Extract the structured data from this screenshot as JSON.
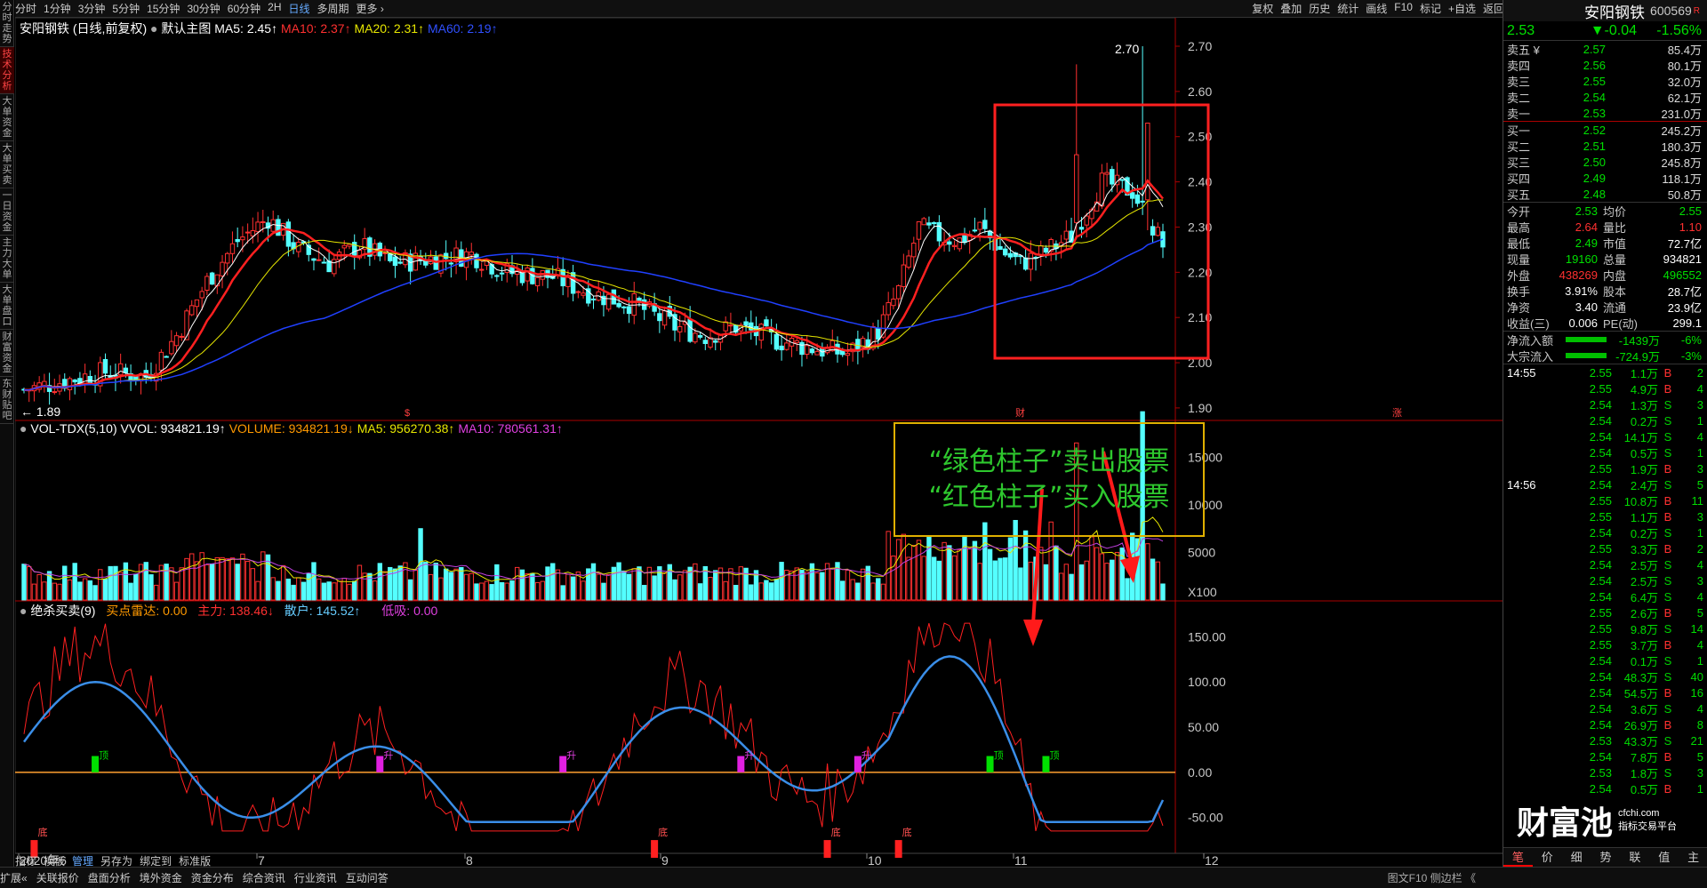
{
  "side_tabs": [
    "分时走势",
    "技术分析",
    "大单资金",
    "大单买卖",
    "一日资金",
    "主力大单",
    "大单盘口",
    "财富资金",
    "东财贴吧"
  ],
  "topbar": {
    "periods": [
      "分时",
      "1分钟",
      "3分钟",
      "5分钟",
      "15分钟",
      "30分钟",
      "60分钟",
      "2H",
      "日线",
      "多周期",
      "更多 ›"
    ],
    "active": "日线",
    "tools": [
      "复权",
      "叠加",
      "历史",
      "统计",
      "画线",
      "F10",
      "标记",
      "+自选",
      "返回"
    ]
  },
  "main": {
    "title": "安阳钢铁 (日线,前复权)",
    "template": "默认主图",
    "ma5": "MA5: 2.45↑",
    "ma10": "MA10: 2.37↑",
    "ma20": "MA20: 2.31↑",
    "ma60": "MA60: 2.19↑",
    "high_label": "2.70",
    "low_label": "1.89",
    "yticks": [
      "2.70",
      "2.60",
      "2.50",
      "2.40",
      "2.30",
      "2.20",
      "2.10",
      "2.00",
      "1.90"
    ],
    "markers": [
      "$",
      "财",
      "涨"
    ]
  },
  "vol": {
    "title": "VOL-TDX(5,10) VVOL: 934821.19↑",
    "volume": "VOLUME: 934821.19↓",
    "ma5": "MA5: 956270.38↑",
    "ma10": "MA10: 780561.31↑",
    "yticks": [
      "15000",
      "10000",
      "5000",
      "X100"
    ]
  },
  "ind": {
    "title": "绝杀买卖(9)",
    "buy": "买点雷达: 0.00",
    "main": "主力: 138.46↓",
    "retail": "散户: 145.52↑",
    "low": "低吸: 0.00",
    "yticks": [
      "150.00",
      "100.00",
      "50.00",
      "0.00",
      "-50.00"
    ],
    "labels": [
      "顶",
      "升",
      "底"
    ]
  },
  "annotation": {
    "line1": "“绿色柱子”卖出股票",
    "line2": "“红色柱子”买入股票"
  },
  "xaxis": [
    "2020年6",
    "7",
    "8",
    "9",
    "10",
    "11",
    "12"
  ],
  "bottom_tabs": [
    "指标",
    "模板",
    "管理",
    "另存为",
    "绑定到",
    "标准版"
  ],
  "bottom_bar": [
    "扩展«",
    "关联报价",
    "盘面分析",
    "境外资金",
    "资金分布",
    "综合资讯",
    "行业资讯",
    "互动问答"
  ],
  "bottom_right": "图文F10 侧边栏 《",
  "right": {
    "name": "安阳钢铁",
    "code": "600569",
    "price": "2.53",
    "change": "▼-0.04",
    "pct": "-1.56%",
    "asks": [
      [
        "卖五 ¥",
        "2.57",
        "85.4万"
      ],
      [
        "卖四",
        "2.56",
        "80.1万"
      ],
      [
        "卖三",
        "2.55",
        "32.0万"
      ],
      [
        "卖二",
        "2.54",
        "62.1万"
      ],
      [
        "卖一",
        "2.53",
        "231.0万"
      ]
    ],
    "bids": [
      [
        "买一",
        "2.52",
        "245.2万"
      ],
      [
        "买二",
        "2.51",
        "180.3万"
      ],
      [
        "买三",
        "2.50",
        "245.8万"
      ],
      [
        "买四",
        "2.49",
        "118.1万"
      ],
      [
        "买五",
        "2.48",
        "50.8万"
      ]
    ],
    "stats": [
      [
        "今开",
        "2.53",
        "均价",
        "2.55"
      ],
      [
        "最高",
        "2.64",
        "量比",
        "1.10"
      ],
      [
        "最低",
        "2.49",
        "市值",
        "72.7亿"
      ],
      [
        "现量",
        "19160",
        "总量",
        "934821"
      ],
      [
        "外盘",
        "438269",
        "内盘",
        "496552"
      ],
      [
        "换手",
        "3.91%",
        "股本",
        "28.7亿"
      ],
      [
        "净资",
        "3.40",
        "流通",
        "23.9亿"
      ],
      [
        "收益(三)",
        "0.006",
        "PE(动)",
        "299.1"
      ]
    ],
    "flows": [
      [
        "净流入额",
        "-1439万",
        "-6%"
      ],
      [
        "大宗流入",
        "-724.9万",
        "-3%"
      ]
    ],
    "ticks": [
      [
        "14:55",
        "2.55",
        "1.1万",
        "B",
        "2"
      ],
      [
        "",
        "2.55",
        "4.9万",
        "B",
        "4"
      ],
      [
        "",
        "2.54",
        "1.3万",
        "S",
        "3"
      ],
      [
        "",
        "2.54",
        "0.2万",
        "S",
        "1"
      ],
      [
        "",
        "2.54",
        "14.1万",
        "S",
        "4"
      ],
      [
        "",
        "2.54",
        "0.5万",
        "S",
        "1"
      ],
      [
        "",
        "2.55",
        "1.9万",
        "B",
        "3"
      ],
      [
        "14:56",
        "2.54",
        "2.4万",
        "S",
        "5"
      ],
      [
        "",
        "2.55",
        "10.8万",
        "B",
        "11"
      ],
      [
        "",
        "2.55",
        "1.1万",
        "B",
        "3"
      ],
      [
        "",
        "2.54",
        "0.2万",
        "S",
        "1"
      ],
      [
        "",
        "2.55",
        "3.3万",
        "B",
        "2"
      ],
      [
        "",
        "2.54",
        "2.5万",
        "S",
        "4"
      ],
      [
        "",
        "2.54",
        "2.5万",
        "S",
        "3"
      ],
      [
        "",
        "2.54",
        "6.4万",
        "S",
        "4"
      ],
      [
        "",
        "2.55",
        "2.6万",
        "B",
        "5"
      ],
      [
        "",
        "2.55",
        "9.8万",
        "S",
        "14"
      ],
      [
        "",
        "2.55",
        "3.7万",
        "B",
        "4"
      ],
      [
        "",
        "2.54",
        "0.1万",
        "S",
        "1"
      ],
      [
        "",
        "2.54",
        "48.3万",
        "S",
        "40"
      ],
      [
        "",
        "2.54",
        "54.5万",
        "B",
        "16"
      ],
      [
        "",
        "2.54",
        "3.6万",
        "S",
        "4"
      ],
      [
        "",
        "2.54",
        "26.9万",
        "B",
        "8"
      ],
      [
        "",
        "2.53",
        "43.3万",
        "S",
        "21"
      ],
      [
        "",
        "2.54",
        "7.8万",
        "B",
        "5"
      ],
      [
        "",
        "2.53",
        "1.8万",
        "S",
        "3"
      ],
      [
        "",
        "2.54",
        "0.5万",
        "B",
        "1"
      ]
    ],
    "tabs": [
      "笔",
      "价",
      "细",
      "势",
      "联",
      "值",
      "主"
    ],
    "watermark": "财富池",
    "watermark_url": "cfchi.com",
    "watermark_sub": "指标交易平台"
  },
  "chart_data": {
    "type": "candlestick",
    "price_range": [
      1.89,
      2.7
    ],
    "vol_range": [
      0,
      17000
    ],
    "ind_range": [
      -70,
      170
    ]
  }
}
